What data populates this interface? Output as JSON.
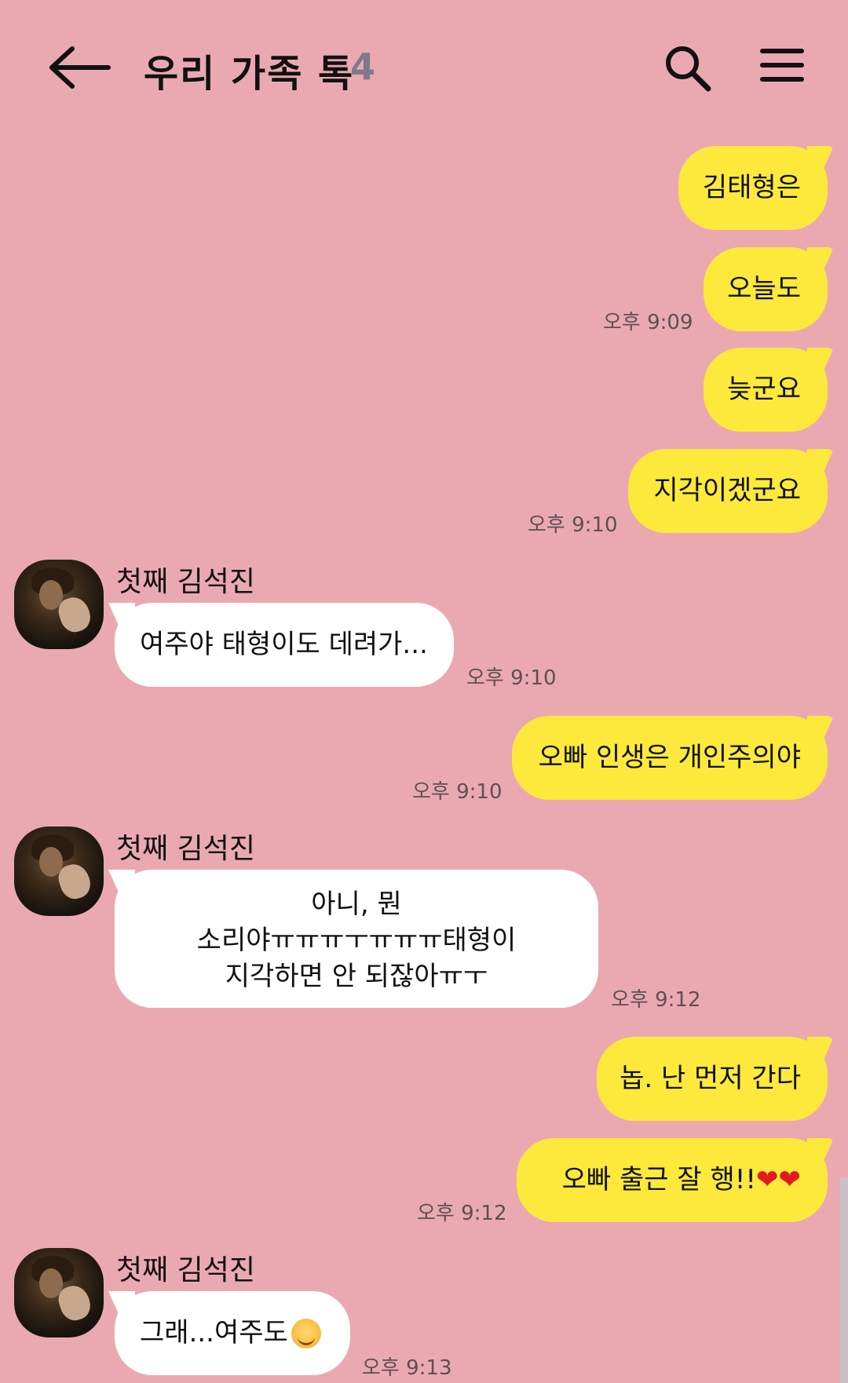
{
  "header": {
    "title": "우리 가족 톡",
    "member_count": "4",
    "back_icon": "arrow-left-icon",
    "search_icon": "search-icon",
    "menu_icon": "menu-icon"
  },
  "colors": {
    "background": "#eaa9b1",
    "my_bubble": "#fde93b",
    "their_bubble": "#ffffff"
  },
  "messages": [
    {
      "text": "김태형은",
      "time": ""
    },
    {
      "text": "오늘도",
      "time": "오후 9:09"
    },
    {
      "text": "늦군요",
      "time": ""
    },
    {
      "text": "지각이겠군요",
      "time": "오후 9:10"
    },
    {
      "sender": "첫째 김석진",
      "text": "여주야 태형이도 데려가...",
      "time": "오후 9:10"
    },
    {
      "text": "오빠 인생은 개인주의야",
      "time": "오후 9:10"
    },
    {
      "sender": "첫째 김석진",
      "lines": [
        "아니, 뭔",
        "소리야ㅠㅠㅠㅜㅠㅠㅠ태형이",
        "지각하면 안 되잖아ㅠㅜ"
      ],
      "time": "오후 9:12"
    },
    {
      "text": "놉. 난 먼저 간다",
      "time": ""
    },
    {
      "text": "오빠 출근 잘 행!!",
      "emoji": "❤❤",
      "time": "오후 9:12"
    },
    {
      "sender": "첫째 김석진",
      "text": "그래...여주도",
      "emoji": "smiling-face-icon",
      "time": "오후 9:13"
    }
  ]
}
